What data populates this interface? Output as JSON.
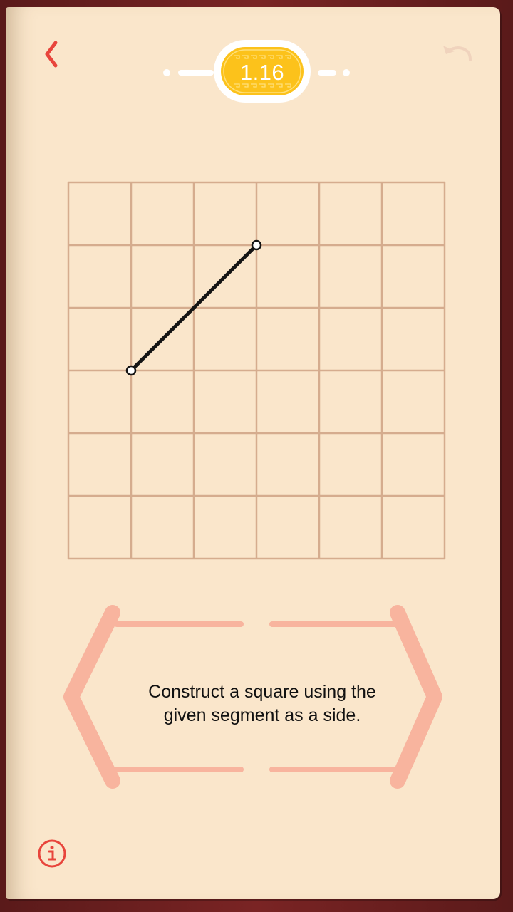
{
  "header": {
    "level": "1.16",
    "back_icon": "chevron-left-icon",
    "undo_icon": "undo-icon"
  },
  "board": {
    "grid_cells": [
      6,
      6
    ],
    "segment": {
      "start": [
        1,
        3
      ],
      "end": [
        3,
        1
      ]
    }
  },
  "instruction": {
    "line1": "Construct a square using the",
    "line2": "given segment as a side."
  },
  "footer": {
    "info_icon": "info-icon"
  },
  "colors": {
    "accent_red": "#e8453c",
    "grid": "#d5ac8e",
    "paper": "#fae6cb",
    "badge_gold": "#fcc21b",
    "frame_salmon": "#f8b49e"
  }
}
